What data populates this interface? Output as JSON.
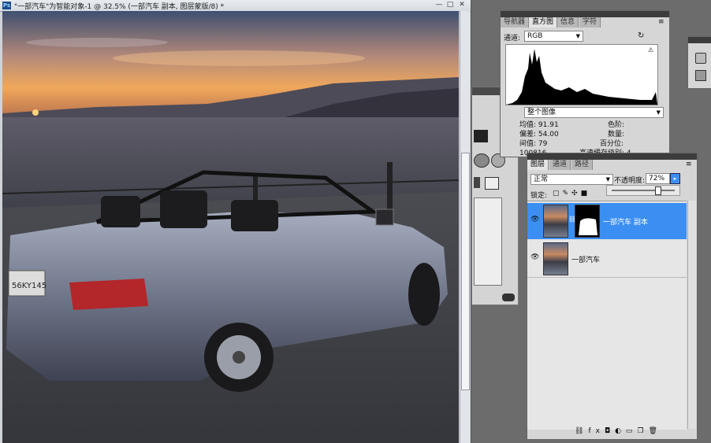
{
  "document": {
    "title": "\"一部汽车\"为智能对象-1 @ 32.5% (一部汽车 副本, 图层蒙版/8) *",
    "app_badge": "Ps",
    "min_glyph": "—",
    "max_glyph": "□",
    "close_glyph": "✕"
  },
  "histogram_panel": {
    "tabs": [
      "导航器",
      "直方图",
      "信息",
      "字符"
    ],
    "channel_label": "通道:",
    "channel_value": "RGB",
    "source_value": "整个图像",
    "stats_left": [
      {
        "label": "均值:",
        "value": "91.91"
      },
      {
        "label": "偏差:",
        "value": "54.00"
      },
      {
        "label": "间值:",
        "value": "79"
      },
      {
        "label": "",
        "value": "100816"
      }
    ],
    "stats_right": [
      "色阶:",
      "数量:",
      "百分位:",
      "高速缓存级别: 4"
    ]
  },
  "layers_panel": {
    "tabs": [
      "图层",
      "通道",
      "路径"
    ],
    "blend_mode": "正常",
    "opacity_label": "不透明度:",
    "opacity_value": "72%",
    "opacity": 0.72,
    "lock_label": "锁定:",
    "layers": [
      {
        "name": "一部汽车 副本",
        "selected": true,
        "has_mask": true
      },
      {
        "name": "一部汽车",
        "selected": false,
        "has_mask": false
      }
    ],
    "footer_icons": [
      "link-icon",
      "fx-icon",
      "mask-icon",
      "adjustment-icon",
      "group-icon",
      "new-layer-icon",
      "trash-icon"
    ]
  },
  "colors": {
    "selection_blue": "#3c8ff2",
    "panel_bg": "#d6d6d6",
    "panel_header": "#3c3c3c"
  }
}
